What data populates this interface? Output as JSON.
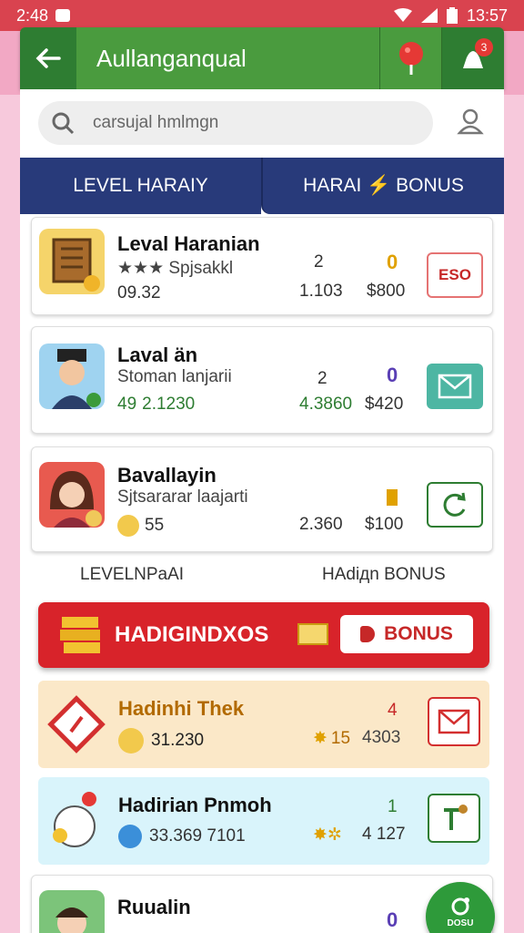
{
  "status_bar": {
    "left_time": "2:48",
    "right_time": "13:57"
  },
  "header": {
    "title": "Aullanganqual",
    "notification_count": "3"
  },
  "search": {
    "placeholder": "carsujal hmlmgn"
  },
  "tabs": [
    {
      "label": "LEVEL HARAIY"
    },
    {
      "label": "HARAI ⚡ BONUS"
    }
  ],
  "cards": [
    {
      "name": "Leval Haranian",
      "subtitle": "★★★ Spjsakkl",
      "value": "09.32",
      "num1": "2",
      "num2": "1.103",
      "num3": "0",
      "num4": "$800",
      "button_label": "ESO"
    },
    {
      "name": "Laval än",
      "subtitle": "Stoman lanjarii",
      "value": "2.1230",
      "value_prefix": "49",
      "num1": "2",
      "num2": "4.3860",
      "num3": "0",
      "num4": "$420"
    },
    {
      "name": "Bavallayin",
      "subtitle": "Sjtsararar laajarti",
      "value": "55",
      "num2": "2.360",
      "num4": "$100"
    }
  ],
  "section": {
    "left": "LEVELNPaAI",
    "right": "HAdiдn BONUS"
  },
  "promo": {
    "label": "HADIGINDXOS",
    "button_label": "BONUS"
  },
  "items": [
    {
      "name": "Hadinhi Thek",
      "value": "31.230",
      "num1": "4",
      "num2": "15",
      "num3": "4303"
    },
    {
      "name": "Hadirian Pnmoh",
      "value": "33.369 7101",
      "num1": "1",
      "num2": "4 127"
    },
    {
      "name": "Ruualin",
      "num1": "0"
    }
  ],
  "fab": {
    "label": "DOSU"
  },
  "colors": {
    "header_green": "#2e7d32",
    "tab_navy": "#283a7a",
    "promo_red": "#d8232a",
    "status_red": "#d9434f",
    "value_green": "#2e7d32",
    "accent_purple": "#5a3fb5",
    "gold": "#e0a100"
  }
}
